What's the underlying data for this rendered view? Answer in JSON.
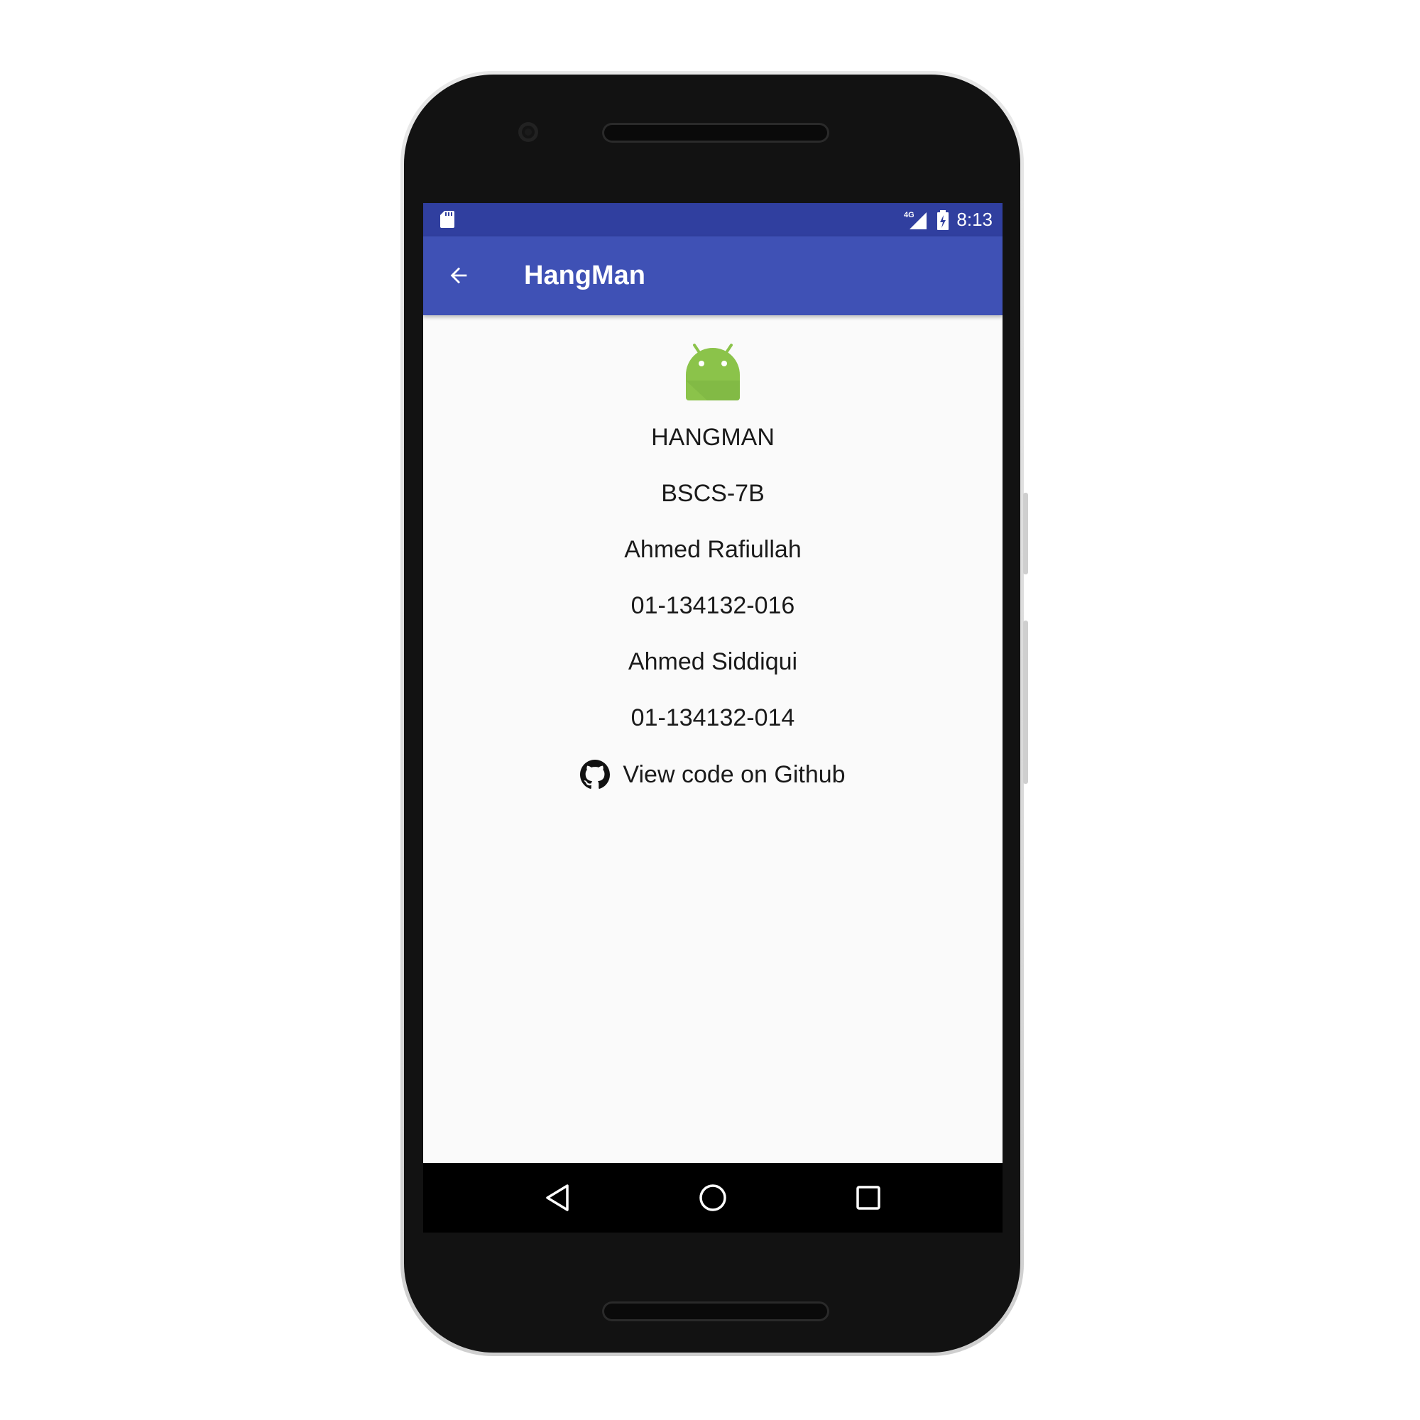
{
  "status_bar": {
    "time": "8:13",
    "network_label": "4G",
    "icons": [
      "sd-card-icon",
      "signal-4g-icon",
      "battery-charging-icon"
    ]
  },
  "app_bar": {
    "title": "HangMan",
    "back_icon": "arrow-back-icon"
  },
  "content": {
    "logo_icon": "android-icon",
    "lines": [
      "HANGMAN",
      "BSCS-7B",
      "Ahmed Rafiullah",
      "01-134132-016",
      "Ahmed Siddiqui",
      "01-134132-014"
    ],
    "github_link": {
      "icon": "github-icon",
      "label": "View code on Github"
    }
  },
  "nav_bar": {
    "icons": [
      "back-triangle-icon",
      "home-circle-icon",
      "recents-square-icon"
    ]
  },
  "colors": {
    "status_bar": "#303f9f",
    "app_bar": "#3f51b5",
    "content_bg": "#fafafa",
    "android_green": "#8bc34a"
  }
}
